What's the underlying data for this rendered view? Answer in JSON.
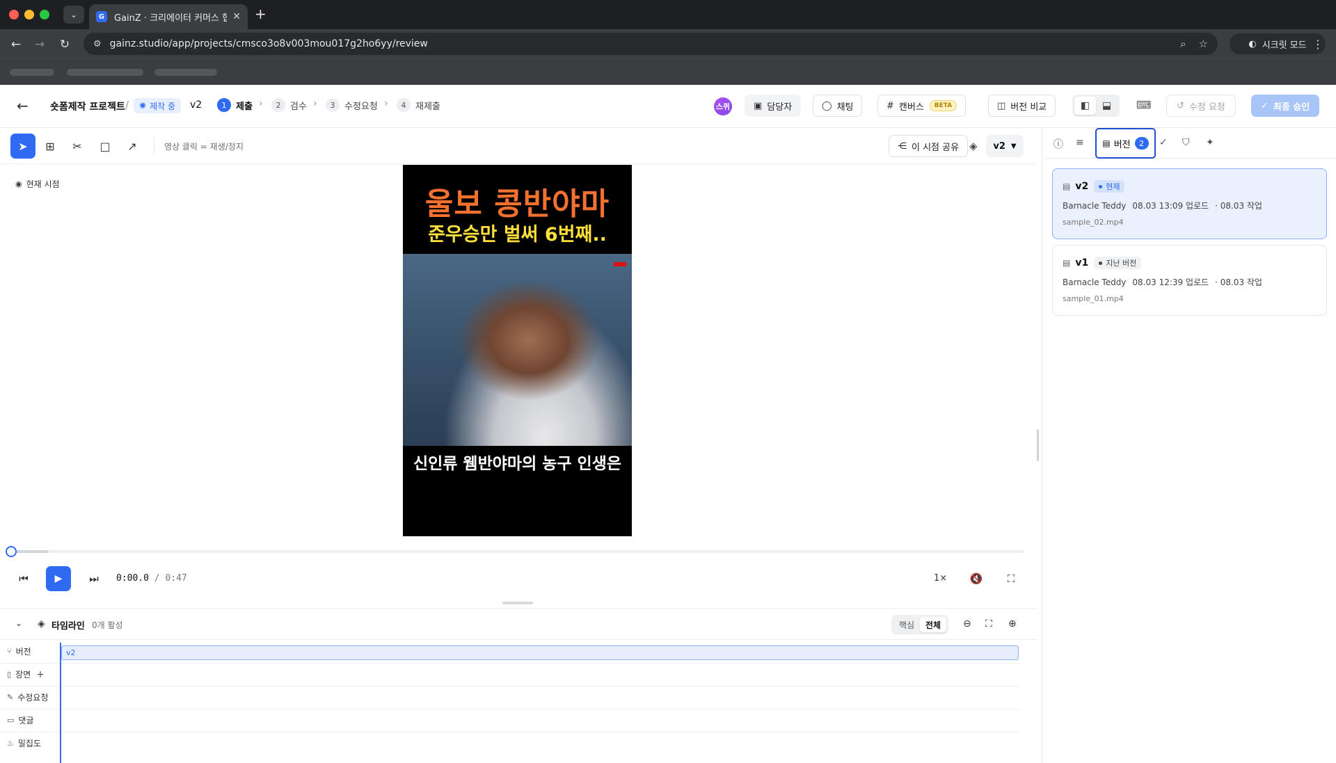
{
  "browser": {
    "tab_title": "GainZ · 크리에이터 커머스 협업 C",
    "favicon": "G",
    "url": "gainz.studio/app/projects/cmsco3o8v003mou017g2ho6yy/review",
    "incognito_label": "시크릿 모드"
  },
  "header": {
    "project_name": "숏폼제작 프로젝트",
    "separator": "/",
    "status": "제작 중",
    "version": "v2",
    "steps": [
      {
        "num": "1",
        "label": "제출"
      },
      {
        "num": "2",
        "label": "검수"
      },
      {
        "num": "3",
        "label": "수정요청"
      },
      {
        "num": "4",
        "label": "재제출"
      }
    ],
    "avatar_initials": "스퀴",
    "assignee_label": "담당자",
    "chat_label": "채팅",
    "canvas_label": "캔버스",
    "beta_label": "BETA",
    "compare_label": "버전 비교",
    "revise_label": "수정 요청",
    "approve_label": "최종 승인"
  },
  "toolbar": {
    "hint": "영상 클릭 = 재생/정지",
    "share_label": "이 시점 공유",
    "version_select": "v2"
  },
  "video": {
    "current_view_label": "현재 시점",
    "title_line1": "울보 콩반야마",
    "title_line2": "준우승만 벌써 6번째..",
    "caption": "신인류 웸반야마의 농구 인생은"
  },
  "player": {
    "current_time": "0:00.0",
    "duration_sep": "/",
    "duration": "0:47",
    "speed": "1×",
    "progress_fraction": 0.0,
    "buffer_fraction": 0.038
  },
  "timeline": {
    "title": "타임라인",
    "active_count": "0개 활성",
    "filter_core": "핵심",
    "filter_all": "전체",
    "tracks": [
      {
        "label": "버전",
        "icon": "branch-icon"
      },
      {
        "label": "장면",
        "icon": "bookmark-icon"
      },
      {
        "label": "수정요청",
        "icon": "pencil-icon"
      },
      {
        "label": "댓글",
        "icon": "comment-icon"
      },
      {
        "label": "밀집도",
        "icon": "flame-icon"
      }
    ],
    "version_clip_label": "v2"
  },
  "right_panel": {
    "versions_tab_label": "버전",
    "versions_count": "2",
    "versions": [
      {
        "name": "v2",
        "badge": "현재",
        "author": "Barnacle Teddy",
        "uploaded": "08.03 13:09 업로드",
        "worked": "· 08.03 작업",
        "file": "sample_02.mp4"
      },
      {
        "name": "v1",
        "badge": "지난 버전",
        "author": "Barnacle Teddy",
        "uploaded": "08.03 12:39 업로드",
        "worked": "· 08.03 작업",
        "file": "sample_01.mp4"
      }
    ]
  },
  "colors": {
    "accent": "#2f6bf2",
    "video_title": "#f2712f",
    "video_subtitle": "#ffe03a"
  }
}
